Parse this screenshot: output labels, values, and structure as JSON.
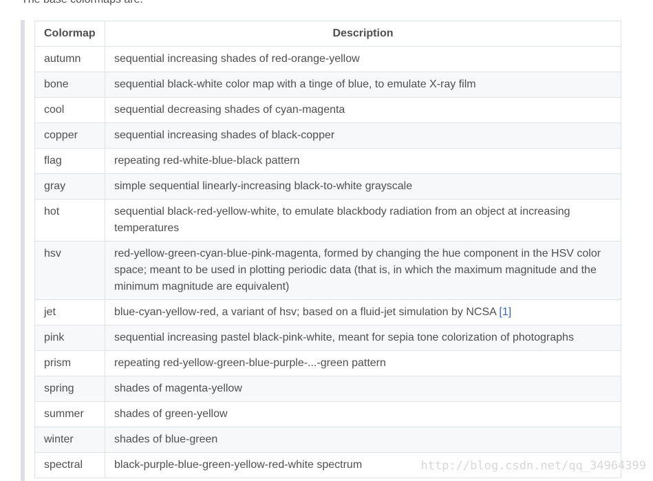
{
  "intro": "The base colormaps are:",
  "table": {
    "headers": {
      "colormap": "Colormap",
      "description": "Description"
    },
    "rows": [
      {
        "name": "autumn",
        "desc": "sequential increasing shades of red-orange-yellow"
      },
      {
        "name": "bone",
        "desc": "sequential black-white color map with a tinge of blue, to emulate X-ray film"
      },
      {
        "name": "cool",
        "desc": "sequential decreasing shades of cyan-magenta"
      },
      {
        "name": "copper",
        "desc": "sequential increasing shades of black-copper"
      },
      {
        "name": "flag",
        "desc": "repeating red-white-blue-black pattern"
      },
      {
        "name": "gray",
        "desc": "simple sequential linearly-increasing black-to-white grayscale"
      },
      {
        "name": "hot",
        "desc": "sequential black-red-yellow-white, to emulate blackbody radiation from an object at increasing temperatures"
      },
      {
        "name": "hsv",
        "desc": "red-yellow-green-cyan-blue-pink-magenta, formed by changing the hue component in the HSV color space; meant to be used in plotting periodic data (that is, in which the maximum magnitude and the minimum magnitude are equivalent)"
      },
      {
        "name": "jet",
        "desc": "blue-cyan-yellow-red, a variant of hsv; based on a fluid-jet simulation by NCSA",
        "ref": "[1]"
      },
      {
        "name": "pink",
        "desc": "sequential increasing pastel black-pink-white, meant for sepia tone colorization of photographs"
      },
      {
        "name": "prism",
        "desc": "repeating red-yellow-green-blue-purple-...-green pattern"
      },
      {
        "name": "spring",
        "desc": "shades of magenta-yellow"
      },
      {
        "name": "summer",
        "desc": "shades of green-yellow"
      },
      {
        "name": "winter",
        "desc": "shades of blue-green"
      },
      {
        "name": "spectral",
        "desc": "black-purple-blue-green-yellow-red-white spectrum"
      }
    ]
  },
  "watermark": "http://blog.csdn.net/qq_34964399",
  "colors": {
    "text": "#4f4f4f",
    "border": "#dfe2e5",
    "stripe": "#f6f8fa",
    "link": "#3366cc",
    "quote_bar": "#dddfe4"
  }
}
